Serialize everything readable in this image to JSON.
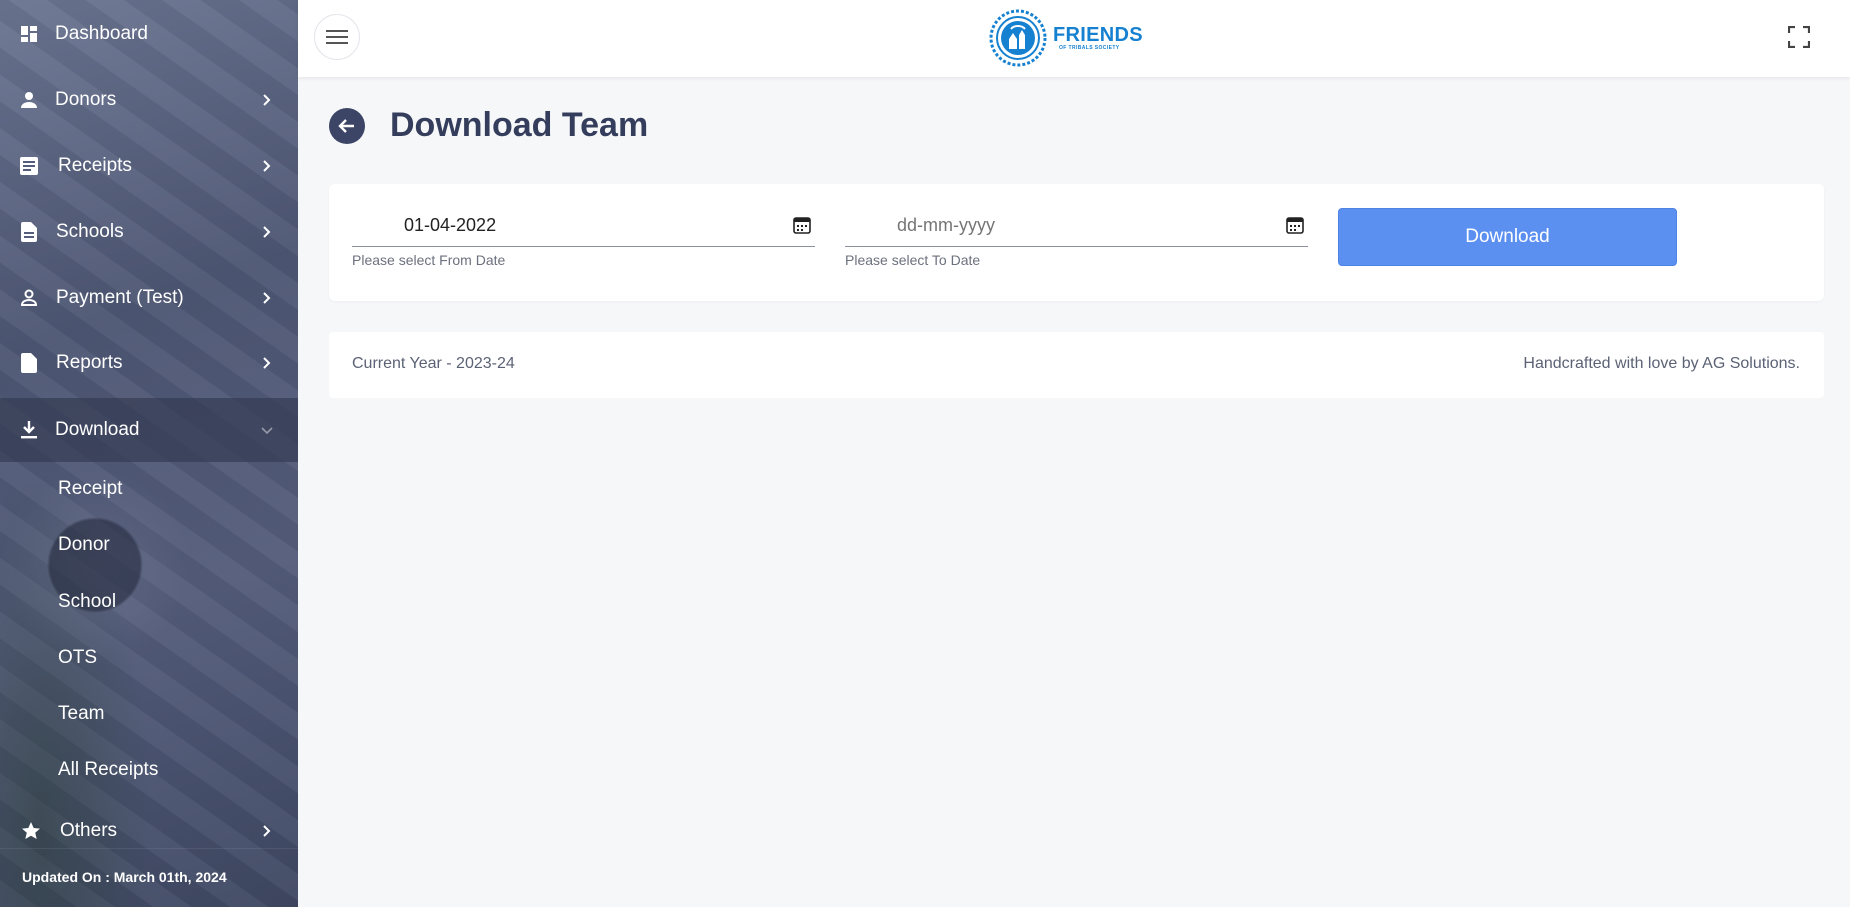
{
  "sidebar": {
    "items": [
      {
        "label": "Dashboard",
        "icon": "dashboard-icon"
      },
      {
        "label": "Donors",
        "icon": "person-icon"
      },
      {
        "label": "Receipts",
        "icon": "list-icon"
      },
      {
        "label": "Schools",
        "icon": "document-icon"
      },
      {
        "label": "Payment (Test)",
        "icon": "person-outline-icon"
      },
      {
        "label": "Reports",
        "icon": "document-icon"
      },
      {
        "label": "Download",
        "icon": "download-icon",
        "expanded": true
      },
      {
        "label": "Others",
        "icon": "star-icon"
      }
    ],
    "download_subitems": [
      "Receipt",
      "Donor",
      "School",
      "OTS",
      "Team",
      "All Receipts"
    ],
    "updated_text": "Updated On : March 01th, 2024"
  },
  "header": {
    "logo_title": "FRIENDS",
    "logo_subtitle": "OF TRIBALS SOCIETY",
    "brand_color": "#1681d0"
  },
  "main": {
    "page_title": "Download Team",
    "from_date": {
      "value": "01-04-2022",
      "hint": "Please select From Date"
    },
    "to_date": {
      "placeholder": "dd-mm-yyyy",
      "hint": "Please select To Date"
    },
    "download_label": "Download",
    "accent_color": "#5b8ff0"
  },
  "footer": {
    "left": "Current Year - 2023-24",
    "right": "Handcrafted with love by AG Solutions."
  }
}
